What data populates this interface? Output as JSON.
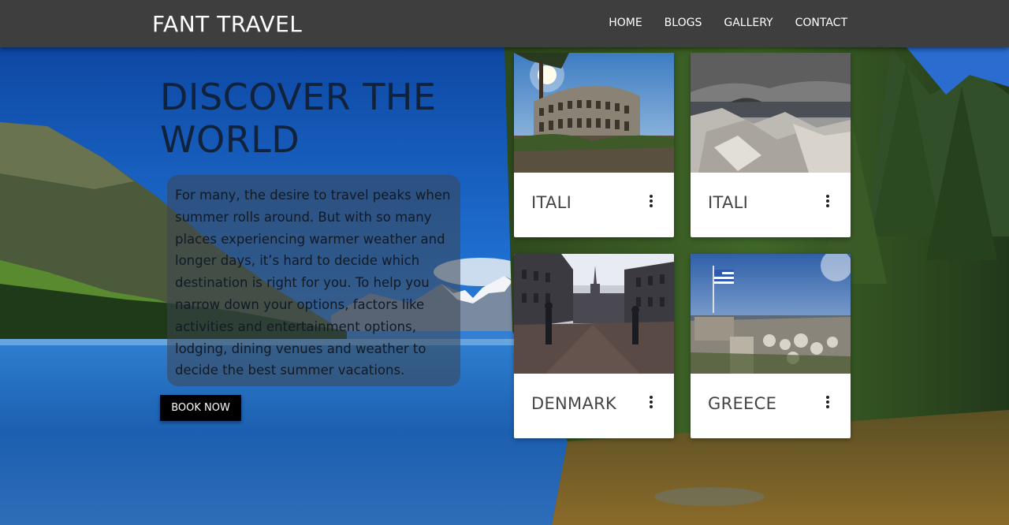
{
  "brand": {
    "name": "FANT TRAVEL"
  },
  "nav": {
    "items": [
      {
        "label": "HOME"
      },
      {
        "label": "BLOGS"
      },
      {
        "label": "GALLERY"
      },
      {
        "label": "CONTACT"
      }
    ]
  },
  "hero": {
    "title": "DISCOVER THE WORLD",
    "text": "For many, the desire to travel peaks when summer rolls around. But with so many places experiencing warmer weather and longer days, it’s hard to decide which destination is right for you. To help you narrow down your options, factors like activities and entertainment options, lodging, dining venues and weather to decide the best summer vacations.",
    "button_label": "BOOK NOW"
  },
  "cards": [
    {
      "title": "ITALI",
      "image": "colosseum"
    },
    {
      "title": "ITALI",
      "image": "rocky-coast"
    },
    {
      "title": "DENMARK",
      "image": "palace-square"
    },
    {
      "title": "GREECE",
      "image": "ruins-flag"
    }
  ],
  "colors": {
    "navbar": "#3e3e3e",
    "title_text": "#10223c",
    "button_bg": "#000000"
  }
}
